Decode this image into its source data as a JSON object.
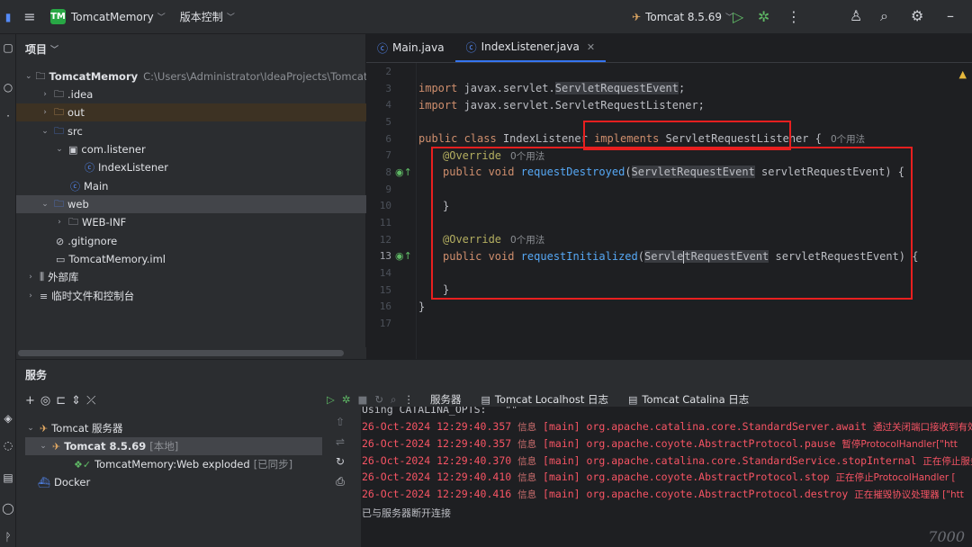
{
  "titlebar": {
    "project_badge": "TM",
    "project_name": "TomcatMemory",
    "vcs_label": "版本控制",
    "run_config": "Tomcat 8.5.69"
  },
  "project_panel": {
    "header": "项目",
    "tree": [
      {
        "label": "TomcatMemory",
        "path": "C:\\Users\\Administrator\\IdeaProjects\\TomcatMemory"
      },
      {
        "label": ".idea"
      },
      {
        "label": "out"
      },
      {
        "label": "src"
      },
      {
        "label": "com.listener"
      },
      {
        "label": "IndexListener"
      },
      {
        "label": "Main"
      },
      {
        "label": "web"
      },
      {
        "label": "WEB-INF"
      },
      {
        "label": ".gitignore"
      },
      {
        "label": "TomcatMemory.iml"
      },
      {
        "label": "外部库"
      },
      {
        "label": "临时文件和控制台"
      }
    ]
  },
  "editor": {
    "tabs": [
      {
        "label": "Main.java"
      },
      {
        "label": "IndexListener.java"
      }
    ],
    "line_numbers": [
      "2",
      "3",
      "4",
      "5",
      "6",
      "7",
      "8",
      "9",
      "10",
      "11",
      "12",
      "13",
      "14",
      "15",
      "16",
      "17"
    ],
    "code": {
      "l3_import": "import",
      "l3_pkg": " javax.servlet.",
      "l3_cls": "ServletRequestEvent",
      "l3_end": ";",
      "l4_import": "import",
      "l4_rest": " javax.servlet.ServletRequestListener;",
      "l6_pub": "public class",
      "l6_name": " IndexListener ",
      "l6_impl": "implements",
      "l6_iface": " ServletRequestListener",
      "l6_brace": " {",
      "usage_hint": "0个用法",
      "override": "@Override",
      "l8_pub": "public void",
      "l8_fn": " requestDestroyed",
      "l8_open": "(",
      "l8_type": "ServletRequestEvent",
      "l8_rest": " servletRequestEvent) {",
      "close_brace": "}",
      "l13_pub": "public void",
      "l13_fn": " requestInitialized",
      "l13_open": "(",
      "l13_type_a": "Servle",
      "l13_type_b": "tRequestEvent",
      "l13_rest": " servletRequestEvent) {"
    }
  },
  "services": {
    "title": "服务",
    "tree": [
      {
        "label": "Tomcat 服务器"
      },
      {
        "label": "Tomcat 8.5.69",
        "status": "[本地]"
      },
      {
        "label": "TomcatMemory:Web exploded",
        "status": "[已同步]"
      },
      {
        "label": "Docker"
      }
    ],
    "tabs": [
      "服务器",
      "Tomcat Localhost 日志",
      "Tomcat Catalina 日志"
    ],
    "console": [
      {
        "text": "Using CATALINA_OPTS:   \"\""
      },
      {
        "time": "26-Oct-2024 12:29:40.357",
        "level": "信息",
        "thread": "[main]",
        "cls": "org.apache.catalina.core.StandardServer.await",
        "msg": "通过关闭端口接收到有效"
      },
      {
        "time": "26-Oct-2024 12:29:40.357",
        "level": "信息",
        "thread": "[main]",
        "cls": "org.apache.coyote.AbstractProtocol.pause",
        "msg": "暂停ProtocolHandler[\"htt"
      },
      {
        "time": "26-Oct-2024 12:29:40.370",
        "level": "信息",
        "thread": "[main]",
        "cls": "org.apache.catalina.core.StandardService.stopInternal",
        "msg": "正在停止服务"
      },
      {
        "time": "26-Oct-2024 12:29:40.410",
        "level": "信息",
        "thread": "[main]",
        "cls": "org.apache.coyote.AbstractProtocol.stop",
        "msg": "正在停止ProtocolHandler ["
      },
      {
        "time": "26-Oct-2024 12:29:40.416",
        "level": "信息",
        "thread": "[main]",
        "cls": "org.apache.coyote.AbstractProtocol.destroy",
        "msg": "正在摧毁协议处理器 [\"htt"
      },
      {
        "text": "已与服务器断开连接"
      }
    ]
  },
  "colors": {
    "accent": "#3574f0",
    "annotation_box": "#e81f1f",
    "error_text": "#f75464"
  },
  "watermark": "7000"
}
